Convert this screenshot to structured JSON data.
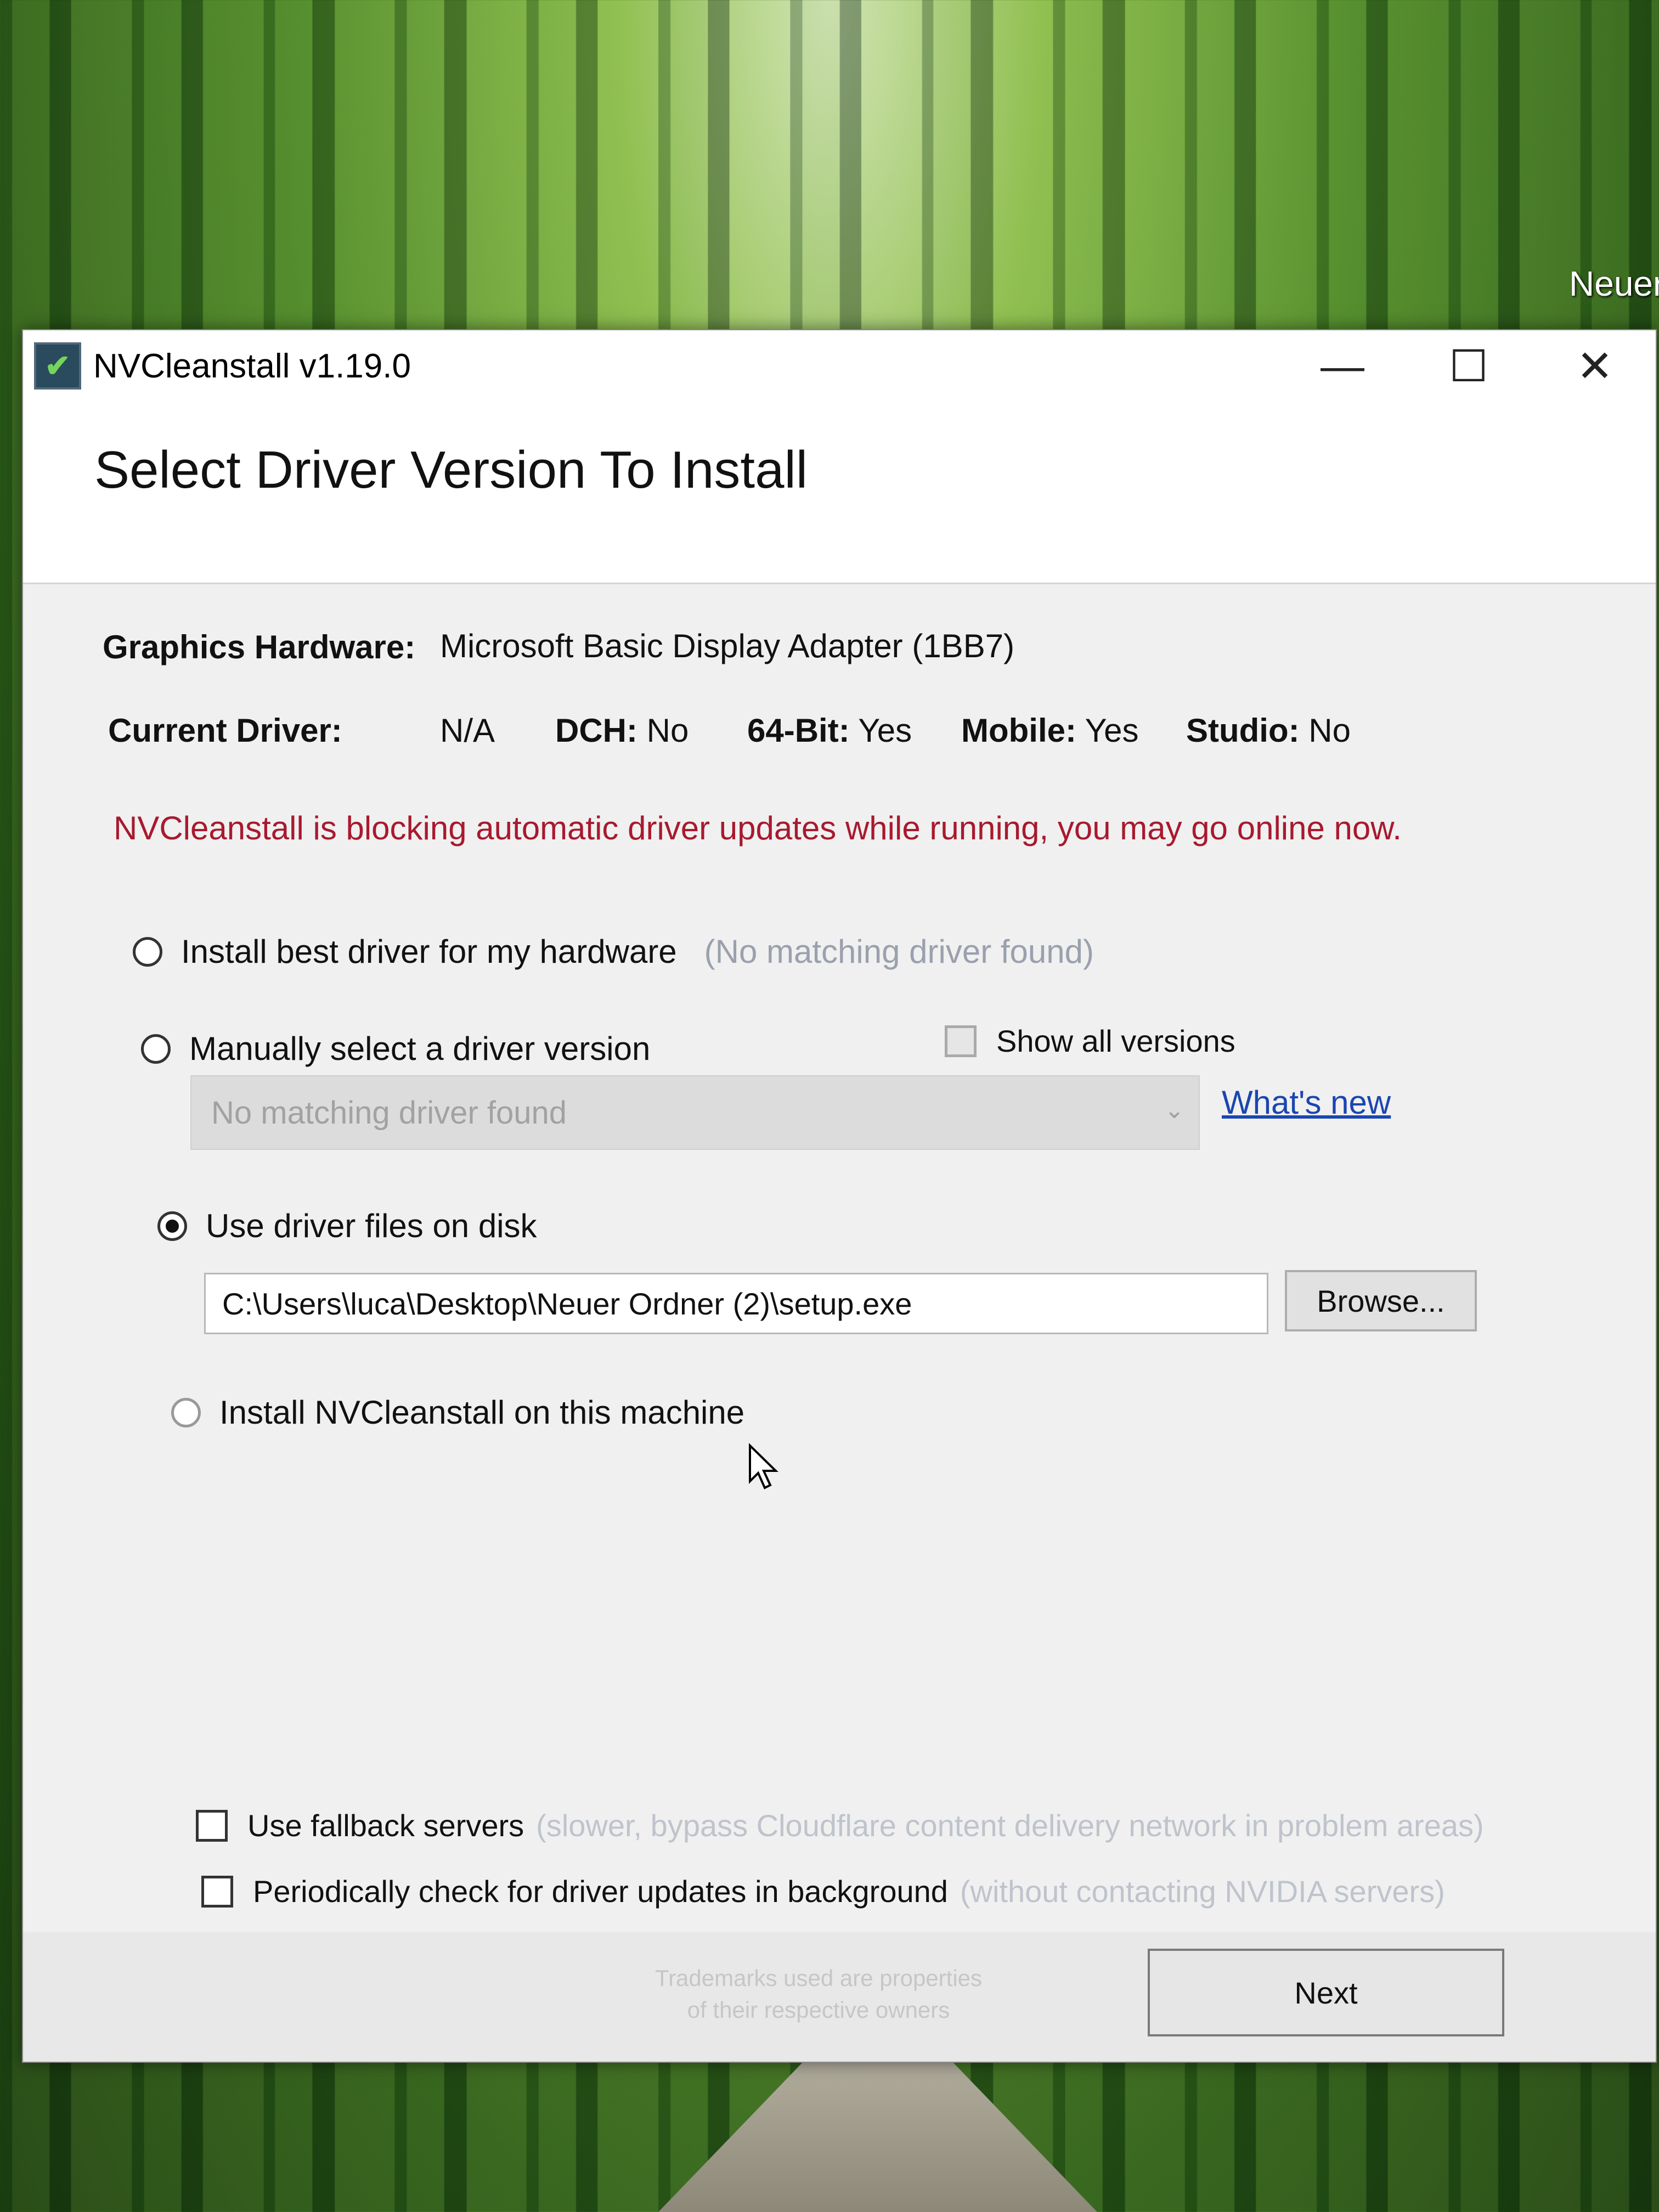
{
  "desktop": {
    "label": "Neuer"
  },
  "window": {
    "title": "NVCleanstall v1.19.0",
    "controls": {
      "minimize": "—",
      "maximize": "☐",
      "close": "✕"
    }
  },
  "header": {
    "title": "Select Driver Version To Install"
  },
  "hardware": {
    "graphics_label": "Graphics Hardware:",
    "graphics_value": "Microsoft Basic Display Adapter (1BB7)",
    "driver_label": "Current Driver:",
    "driver_value": "N/A",
    "dch_label": "DCH:",
    "dch_value": "No",
    "bit64_label": "64-Bit:",
    "bit64_value": "Yes",
    "mobile_label": "Mobile:",
    "mobile_value": "Yes",
    "studio_label": "Studio:",
    "studio_value": "No"
  },
  "warning": "NVCleanstall is blocking automatic driver updates while running, you may go online now.",
  "options": {
    "best_driver": {
      "label": "Install best driver for my hardware",
      "hint": "(No matching driver found)"
    },
    "manual": {
      "label": "Manually select a driver version"
    },
    "show_all": {
      "label": "Show all versions"
    },
    "dropdown": {
      "value": "No matching driver found"
    },
    "whats_new": "What's new",
    "use_disk": {
      "label": "Use driver files on disk"
    },
    "disk_path": "C:\\Users\\luca\\Desktop\\Neuer Ordner (2)\\setup.exe",
    "browse": "Browse...",
    "install_self": {
      "label": "Install NVCleanstall on this machine"
    }
  },
  "checks": {
    "fallback": {
      "label": "Use fallback servers",
      "hint": "(slower, bypass Cloudflare content delivery network in problem areas)"
    },
    "periodic": {
      "label": "Periodically check for driver updates in background",
      "hint": "(without contacting NVIDIA servers)"
    }
  },
  "footer": {
    "trademark_line1": "Trademarks used are properties",
    "trademark_line2": "of their respective owners",
    "next": "Next"
  },
  "colors": {
    "warning": "#a8192e",
    "link": "#1b46b0",
    "hint": "#9aa0ad"
  }
}
